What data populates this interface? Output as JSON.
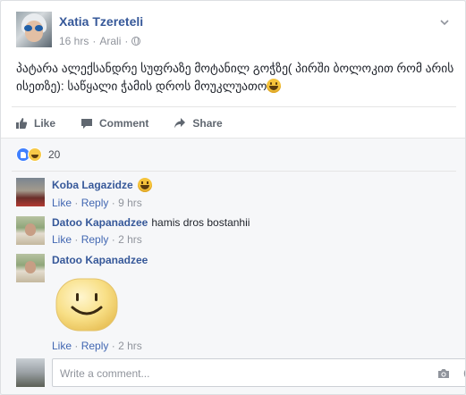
{
  "post": {
    "author": "Xatia Tzereteli",
    "time": "16 hrs",
    "separator": "·",
    "location": "Arali",
    "audience_icon": "globe-icon",
    "text": "პატარა ალექსანდრე სუფრაზე მოტანილ გოჭზე( პირში ბოლოკით რომ არის ისეთზე): საწყალი ჭამის დროს მოუკლუათო",
    "emoji": "grinning-face-emoji"
  },
  "actions": {
    "like": "Like",
    "comment": "Comment",
    "share": "Share"
  },
  "reactions": {
    "types": [
      "like",
      "haha"
    ],
    "count": "20"
  },
  "comments": [
    {
      "author": "Koba Lagazidze",
      "text": "",
      "emoji": "grinning-face-emoji",
      "like": "Like",
      "reply": "Reply",
      "dot": "·",
      "time": "9 hrs"
    },
    {
      "author": "Datoo Kapanadzee",
      "text": "hamis dros bostanhii",
      "like": "Like",
      "reply": "Reply",
      "dot": "·",
      "time": "2 hrs"
    },
    {
      "author": "Datoo Kapanadzee",
      "text": "",
      "sticker": "smiley-sticker",
      "like": "Like",
      "reply": "Reply",
      "dot": "·",
      "time": "2 hrs"
    }
  ],
  "composer": {
    "placeholder": "Write a comment...",
    "icons": [
      "camera-icon",
      "sticker-icon"
    ]
  },
  "colors": {
    "link": "#365899",
    "meta": "#90949c",
    "action_text": "#606770",
    "like_blue": "#4080ff",
    "emoji_yellow": "#f5c33b"
  }
}
